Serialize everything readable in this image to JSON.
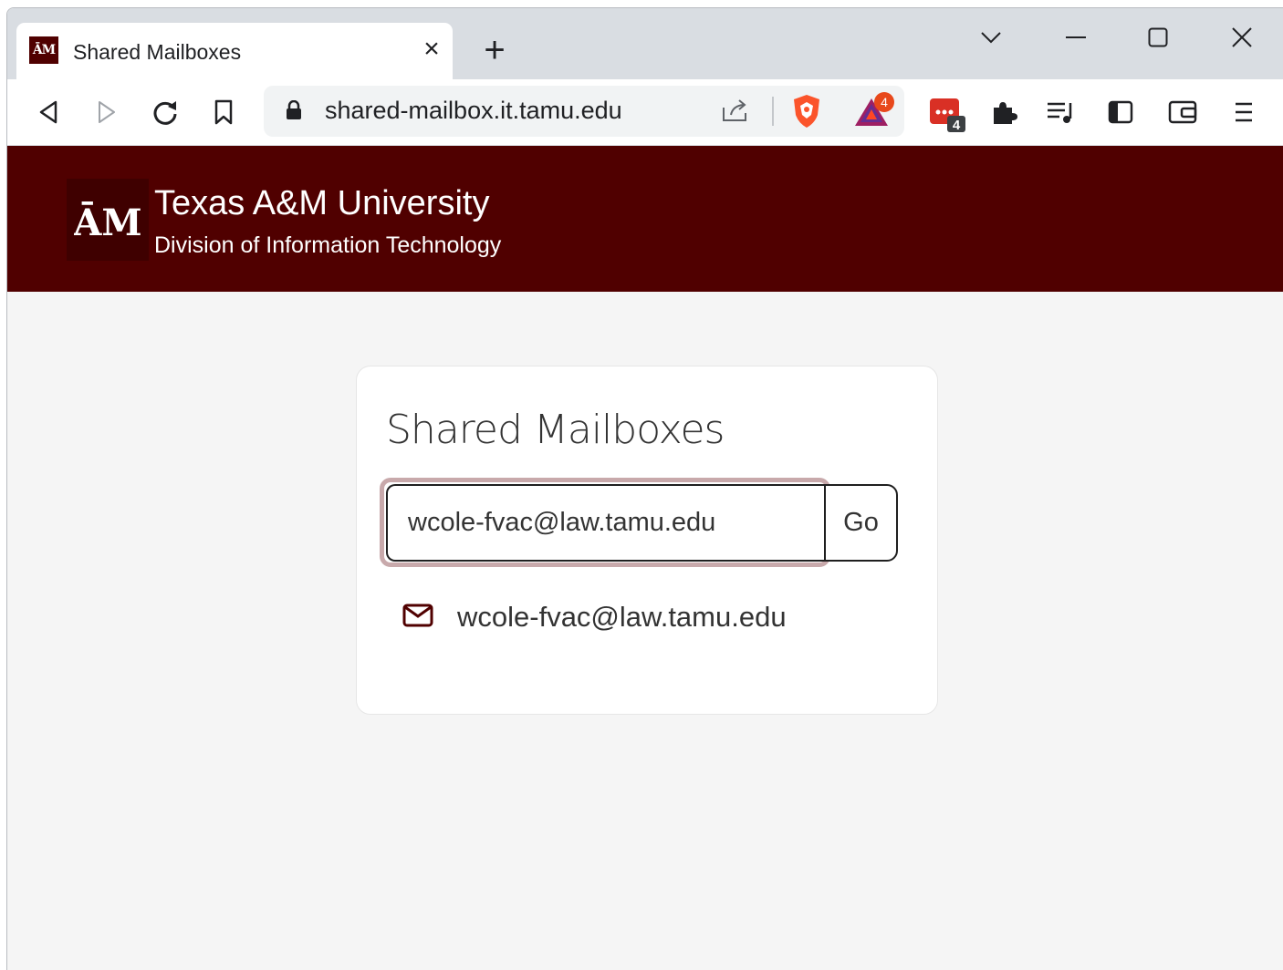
{
  "browser": {
    "tab": {
      "favicon_text": "ĀM",
      "title": "Shared Mailboxes"
    },
    "address": {
      "url": "shared-mailbox.it.tamu.edu"
    },
    "extension_badges": {
      "bat_count": "4",
      "ext_count": "4"
    }
  },
  "header": {
    "logo_text": "ĀM",
    "title": "Texas A&M University",
    "subtitle": "Division of Information Technology"
  },
  "card": {
    "title": "Shared Mailboxes",
    "search": {
      "value": "wcole-fvac@law.tamu.edu"
    },
    "go_label": "Go",
    "results": [
      {
        "email": "wcole-fvac@law.tamu.edu"
      }
    ]
  },
  "colors": {
    "brand": "#500000",
    "focus_ring": "#c8a9ab"
  }
}
